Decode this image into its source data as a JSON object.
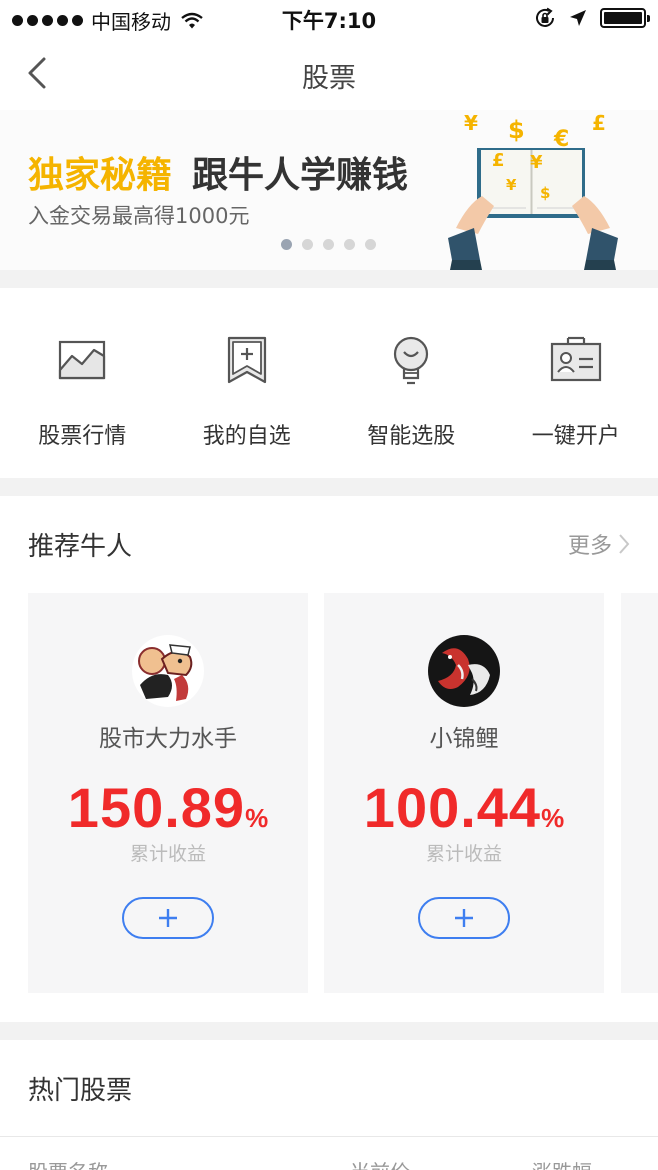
{
  "status_bar": {
    "carrier": "中国移动",
    "time": "下午7:10"
  },
  "nav": {
    "title": "股票"
  },
  "banner": {
    "headline_highlight": "独家秘籍",
    "headline_rest": "跟牛人学赚钱",
    "subtitle": "入金交易最高得1000元",
    "page_count": 5,
    "active_page": 1,
    "currency_symbols": [
      "¥",
      "$",
      "£",
      "€",
      "£",
      "¥",
      "¥",
      "$"
    ]
  },
  "quick_actions": [
    {
      "label": "股票行情",
      "icon": "chart-icon"
    },
    {
      "label": "我的自选",
      "icon": "bookmark-add-icon"
    },
    {
      "label": "智能选股",
      "icon": "lightbulb-icon"
    },
    {
      "label": "一键开户",
      "icon": "id-card-icon"
    }
  ],
  "recommended": {
    "title": "推荐牛人",
    "more_label": "更多",
    "cards": [
      {
        "name": "股市大力水手",
        "return_value": "150.89",
        "return_unit": "%",
        "caption": "累计收益"
      },
      {
        "name": "小锦鲤",
        "return_value": "100.44",
        "return_unit": "%",
        "caption": "累计收益"
      }
    ]
  },
  "hot_stocks": {
    "title": "热门股票",
    "columns": [
      "股票名称",
      "当前价",
      "涨跌幅"
    ]
  },
  "colors": {
    "accent_blue": "#3e7ef0",
    "gain_red": "#f02a2a",
    "banner_yellow": "#f5b400"
  }
}
